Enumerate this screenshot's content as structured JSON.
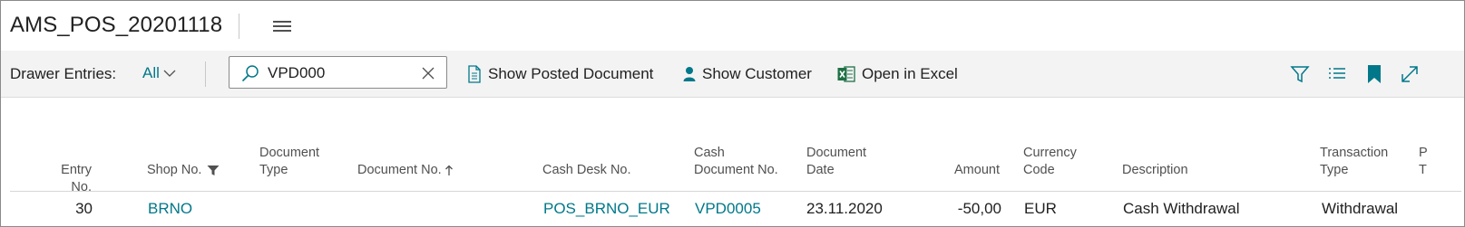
{
  "page": {
    "title": "AMS_POS_20201118"
  },
  "actionbar": {
    "view_label": "Drawer Entries:",
    "view_selected": "All",
    "search_value": "VPD000",
    "actions": {
      "show_posted_document": "Show Posted Document",
      "show_customer": "Show Customer",
      "open_in_excel": "Open in Excel"
    },
    "icons": [
      "filter-icon",
      "list-view-icon",
      "bookmark-icon",
      "expand-icon"
    ]
  },
  "grid": {
    "columns": {
      "entry_no": "Entry No.",
      "shop_no": "Shop No.",
      "document_type_1": "Document",
      "document_type_2": "Type",
      "document_no": "Document No.",
      "cash_desk_no": "Cash Desk No.",
      "cash_document_no_1": "Cash",
      "cash_document_no_2": "Document No.",
      "document_date_1": "Document",
      "document_date_2": "Date",
      "amount": "Amount",
      "currency_code_1": "Currency",
      "currency_code_2": "Code",
      "description": "Description",
      "transaction_type_1": "Transaction",
      "transaction_type_2": "Type",
      "truncated_1": "P",
      "truncated_2": "T"
    },
    "rows": [
      {
        "entry_no": "30",
        "shop_no": "BRNO",
        "document_type": "",
        "document_no": "",
        "cash_desk_no": "POS_BRNO_EUR",
        "cash_document_no": "VPD0005",
        "document_date": "23.11.2020",
        "amount": "-50,00",
        "currency_code": "EUR",
        "description": "Cash Withdrawal",
        "transaction_type": "Withdrawal"
      }
    ]
  },
  "colors": {
    "accent": "#00788a",
    "text": "#212121",
    "header_text": "#505050",
    "excel_green": "#1e7145"
  }
}
